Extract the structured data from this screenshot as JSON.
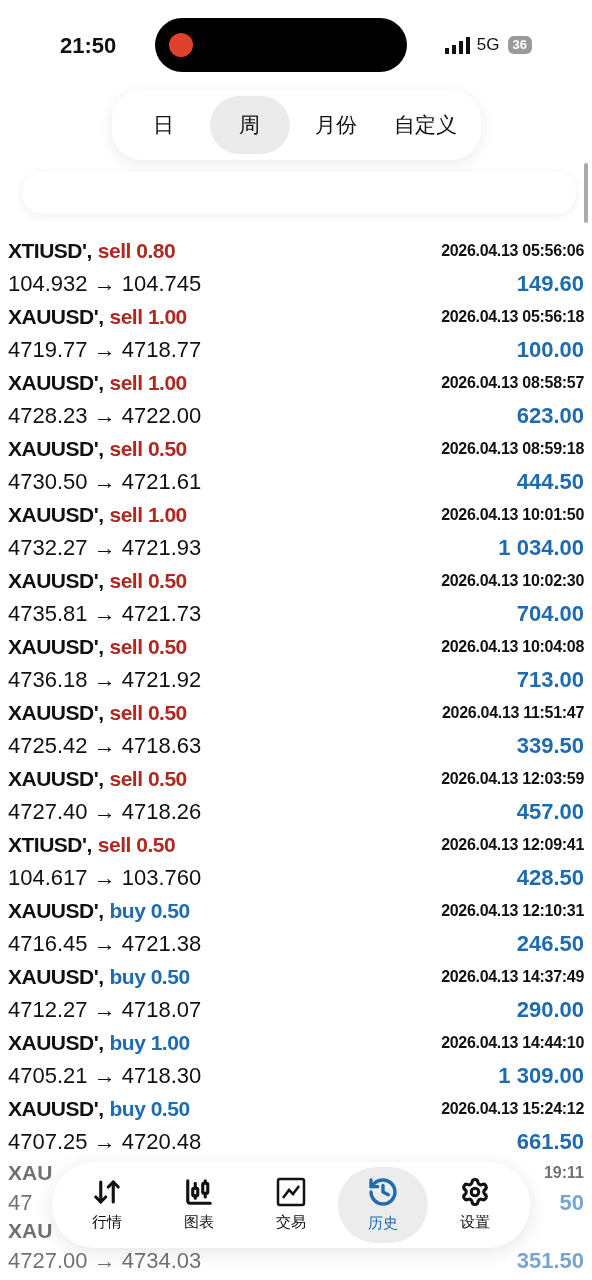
{
  "status_bar": {
    "time": "21:50",
    "network": "5G",
    "battery": "36"
  },
  "period_tabs": [
    {
      "label": "日",
      "selected": false
    },
    {
      "label": "周",
      "selected": true
    },
    {
      "label": "月份",
      "selected": false
    },
    {
      "label": "自定义",
      "selected": false
    }
  ],
  "deals": [
    {
      "symbol": "XTIUSD',",
      "order": "sell 0.80",
      "kind": "sell",
      "time": "2026.04.13 05:56:06",
      "prices": "104.932 → 104.745",
      "profit": "149.60"
    },
    {
      "symbol": "XAUUSD',",
      "order": "sell 1.00",
      "kind": "sell",
      "time": "2026.04.13 05:56:18",
      "prices": "4719.77 → 4718.77",
      "profit": "100.00"
    },
    {
      "symbol": "XAUUSD',",
      "order": "sell 1.00",
      "kind": "sell",
      "time": "2026.04.13 08:58:57",
      "prices": "4728.23 → 4722.00",
      "profit": "623.00"
    },
    {
      "symbol": "XAUUSD',",
      "order": "sell 0.50",
      "kind": "sell",
      "time": "2026.04.13 08:59:18",
      "prices": "4730.50 → 4721.61",
      "profit": "444.50"
    },
    {
      "symbol": "XAUUSD',",
      "order": "sell 1.00",
      "kind": "sell",
      "time": "2026.04.13 10:01:50",
      "prices": "4732.27 → 4721.93",
      "profit": "1 034.00"
    },
    {
      "symbol": "XAUUSD',",
      "order": "sell 0.50",
      "kind": "sell",
      "time": "2026.04.13 10:02:30",
      "prices": "4735.81 → 4721.73",
      "profit": "704.00"
    },
    {
      "symbol": "XAUUSD',",
      "order": "sell 0.50",
      "kind": "sell",
      "time": "2026.04.13 10:04:08",
      "prices": "4736.18 → 4721.92",
      "profit": "713.00"
    },
    {
      "symbol": "XAUUSD',",
      "order": "sell 0.50",
      "kind": "sell",
      "time": "2026.04.13 11:51:47",
      "prices": "4725.42 → 4718.63",
      "profit": "339.50"
    },
    {
      "symbol": "XAUUSD',",
      "order": "sell 0.50",
      "kind": "sell",
      "time": "2026.04.13 12:03:59",
      "prices": "4727.40 → 4718.26",
      "profit": "457.00"
    },
    {
      "symbol": "XTIUSD',",
      "order": "sell 0.50",
      "kind": "sell",
      "time": "2026.04.13 12:09:41",
      "prices": "104.617 → 103.760",
      "profit": "428.50"
    },
    {
      "symbol": "XAUUSD',",
      "order": "buy 0.50",
      "kind": "buy",
      "time": "2026.04.13 12:10:31",
      "prices": "4716.45 → 4721.38",
      "profit": "246.50"
    },
    {
      "symbol": "XAUUSD',",
      "order": "buy 0.50",
      "kind": "buy",
      "time": "2026.04.13 14:37:49",
      "prices": "4712.27 → 4718.07",
      "profit": "290.00"
    },
    {
      "symbol": "XAUUSD',",
      "order": "buy 1.00",
      "kind": "buy",
      "time": "2026.04.13 14:44:10",
      "prices": "4705.21 → 4718.30",
      "profit": "1 309.00"
    },
    {
      "symbol": "XAUUSD',",
      "order": "buy 0.50",
      "kind": "buy",
      "time": "2026.04.13 15:24:12",
      "prices": "4707.25 → 4720.48",
      "profit": "661.50"
    }
  ],
  "covered_deals": [
    {
      "symbol": "XAU",
      "time": "19:11",
      "prices": "47",
      "profit": "50"
    },
    {
      "symbol": "XAU",
      "prices": "4727.00 → 4734.03",
      "profit": "351.50"
    }
  ],
  "bottom_nav": [
    {
      "label": "行情",
      "kind": "quotes",
      "selected": false
    },
    {
      "label": "图表",
      "kind": "chart",
      "selected": false
    },
    {
      "label": "交易",
      "kind": "trade",
      "selected": false
    },
    {
      "label": "历史",
      "kind": "history",
      "selected": true
    },
    {
      "label": "设置",
      "kind": "settings",
      "selected": false
    }
  ]
}
